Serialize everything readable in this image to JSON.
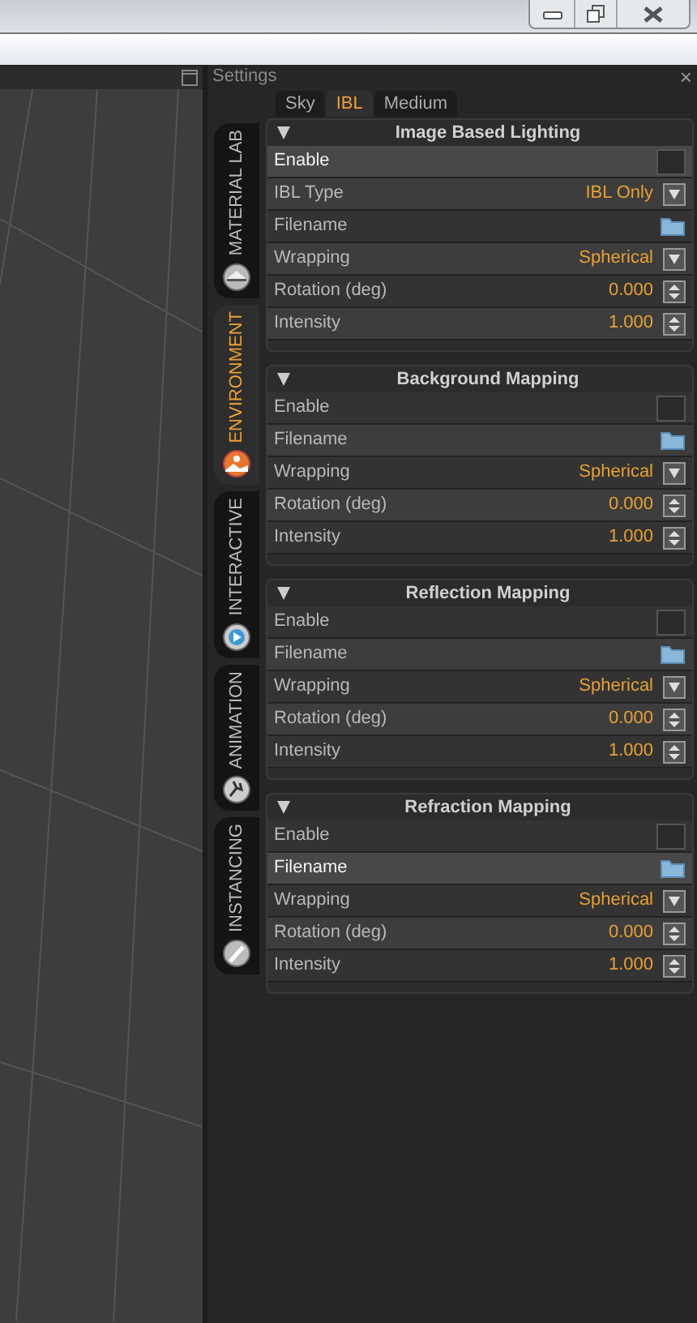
{
  "panel": {
    "title": "Settings",
    "close": "×"
  },
  "side_tabs": [
    {
      "label": "MATERIAL LAB",
      "selected": false
    },
    {
      "label": "ENVIRONMENT",
      "selected": true
    },
    {
      "label": "INTERACTIVE",
      "selected": false
    },
    {
      "label": "ANIMATION",
      "selected": false
    },
    {
      "label": "INSTANCING",
      "selected": false
    }
  ],
  "tabs": [
    {
      "label": "Sky",
      "selected": false
    },
    {
      "label": "IBL",
      "selected": true
    },
    {
      "label": "Medium",
      "selected": false
    }
  ],
  "sections": [
    {
      "title": "Image Based Lighting",
      "expanded": true,
      "rows": [
        {
          "kind": "checkbox",
          "label": "Enable",
          "checked": false,
          "highlighted": true
        },
        {
          "kind": "dropdown",
          "label": "IBL Type",
          "value": "IBL Only",
          "highlighted": false
        },
        {
          "kind": "file",
          "label": "Filename",
          "highlighted": false
        },
        {
          "kind": "dropdown",
          "label": "Wrapping",
          "value": "Spherical",
          "highlighted": false
        },
        {
          "kind": "spinner",
          "label": "Rotation (deg)",
          "value": "0.000",
          "highlighted": false
        },
        {
          "kind": "spinner",
          "label": "Intensity",
          "value": "1.000",
          "highlighted": false
        }
      ]
    },
    {
      "title": "Background Mapping",
      "expanded": true,
      "rows": [
        {
          "kind": "checkbox",
          "label": "Enable",
          "checked": false,
          "highlighted": false
        },
        {
          "kind": "file",
          "label": "Filename",
          "highlighted": false
        },
        {
          "kind": "dropdown",
          "label": "Wrapping",
          "value": "Spherical",
          "highlighted": false
        },
        {
          "kind": "spinner",
          "label": "Rotation (deg)",
          "value": "0.000",
          "highlighted": false
        },
        {
          "kind": "spinner",
          "label": "Intensity",
          "value": "1.000",
          "highlighted": false
        }
      ]
    },
    {
      "title": "Reflection Mapping",
      "expanded": true,
      "rows": [
        {
          "kind": "checkbox",
          "label": "Enable",
          "checked": false,
          "highlighted": false
        },
        {
          "kind": "file",
          "label": "Filename",
          "highlighted": false
        },
        {
          "kind": "dropdown",
          "label": "Wrapping",
          "value": "Spherical",
          "highlighted": false
        },
        {
          "kind": "spinner",
          "label": "Rotation (deg)",
          "value": "0.000",
          "highlighted": false
        },
        {
          "kind": "spinner",
          "label": "Intensity",
          "value": "1.000",
          "highlighted": false
        }
      ]
    },
    {
      "title": "Refraction Mapping",
      "expanded": true,
      "rows": [
        {
          "kind": "checkbox",
          "label": "Enable",
          "checked": false,
          "highlighted": false
        },
        {
          "kind": "file",
          "label": "Filename",
          "highlighted": true
        },
        {
          "kind": "dropdown",
          "label": "Wrapping",
          "value": "Spherical",
          "highlighted": false
        },
        {
          "kind": "spinner",
          "label": "Rotation (deg)",
          "value": "0.000",
          "highlighted": false
        },
        {
          "kind": "spinner",
          "label": "Intensity",
          "value": "1.000",
          "highlighted": false
        }
      ]
    }
  ]
}
